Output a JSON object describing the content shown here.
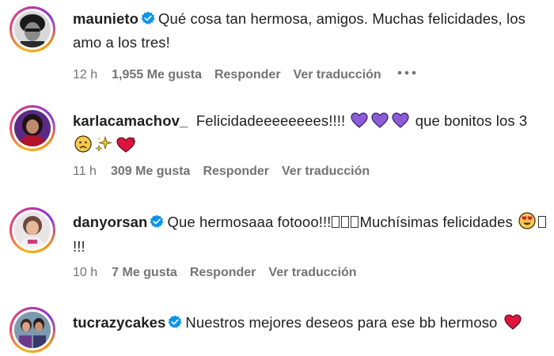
{
  "comments": [
    {
      "username": "maunieto",
      "verified": true,
      "text": "Qué cosa tan hermosa, amigos. Muchas felicidades, los amo a los tres!",
      "time": "12 h",
      "likes": "1,955 Me gusta",
      "reply": "Responder",
      "translate": "Ver traducción",
      "more": "•••"
    },
    {
      "username": "karlacamachov_",
      "verified": false,
      "text_part1": "Felicidadeeeeeeees!!!!",
      "text_part2": "que bonitos los 3",
      "time": "11 h",
      "likes": "309 Me gusta",
      "reply": "Responder",
      "translate": "Ver traducción"
    },
    {
      "username": "danyorsan",
      "verified": true,
      "text_part1": "Que hermosaaa fotooo!!!",
      "text_part2": "Muchísimas felicidades",
      "text_part3": "!!!",
      "time": "10 h",
      "likes": "7 Me gusta",
      "reply": "Responder",
      "translate": "Ver traducción"
    },
    {
      "username": "tucrazycakes",
      "verified": true,
      "text": "Nuestros mejores deseos para ese bb hermoso"
    }
  ],
  "colors": {
    "meta_text": "#737373",
    "verified_blue": "#0095f6",
    "purple_heart": "#8c5bd9",
    "red_heart": "#e0143c"
  },
  "icons": [
    "verified-badge-icon",
    "more-options-icon",
    "purple-heart-emoji",
    "sparkles-emoji",
    "red-heart-emoji",
    "sad-face-emoji",
    "heart-eyes-emoji"
  ]
}
